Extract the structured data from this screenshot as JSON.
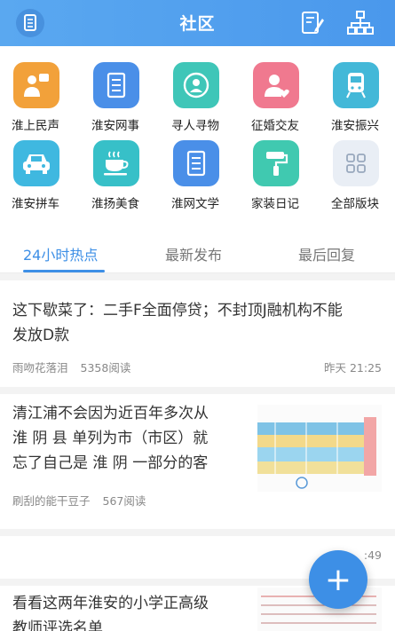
{
  "header": {
    "title": "社区"
  },
  "grid": {
    "row1": [
      {
        "label": "淮上民声",
        "icon": "speaker-person-icon",
        "color": "#f2a13a"
      },
      {
        "label": "淮安网事",
        "icon": "list-clipboard-icon",
        "color": "#4a8fe8"
      },
      {
        "label": "寻人寻物",
        "icon": "person-circle-icon",
        "color": "#3fc6b8"
      },
      {
        "label": "征婚交友",
        "icon": "heart-person-icon",
        "color": "#f0798f"
      },
      {
        "label": "淮安振兴",
        "icon": "train-icon",
        "color": "#43b8d8"
      }
    ],
    "row2": [
      {
        "label": "淮安拼车",
        "icon": "car-icon",
        "color": "#3fb8e0"
      },
      {
        "label": "淮扬美食",
        "icon": "coffee-cup-icon",
        "color": "#37c0c8"
      },
      {
        "label": "淮网文学",
        "icon": "document-list-icon",
        "color": "#4a8fe8"
      },
      {
        "label": "家装日记",
        "icon": "paint-roller-icon",
        "color": "#40c9b0"
      },
      {
        "label": "全部版块",
        "icon": "grid-icon",
        "color": "#e9eef5"
      }
    ]
  },
  "tabs": [
    {
      "label": "24小时热点",
      "active": true
    },
    {
      "label": "最新发布",
      "active": false
    },
    {
      "label": "最后回复",
      "active": false
    }
  ],
  "posts": [
    {
      "title_line1": "这下歇菜了：二手F全面停贷；不封顶J融机构不能",
      "title_line2": "发放D款",
      "author": "雨吻花落泪",
      "reads": "5358阅读",
      "time": "昨天 21:25"
    },
    {
      "title_line1": "清江浦不会因为近百年多次从",
      "title_line2": "淮 阴 县 单列为市（市区）就",
      "title_line3": "忘了自己是 淮 阴 一部分的客",
      "author": "刷刮的能干豆子",
      "reads": "567阅读",
      "time": ""
    },
    {
      "time": ":49"
    },
    {
      "title_line1": "看看这两年淮安的小学正高级",
      "title_line2": "教师评选名单"
    }
  ],
  "fab": {
    "label": "+"
  }
}
